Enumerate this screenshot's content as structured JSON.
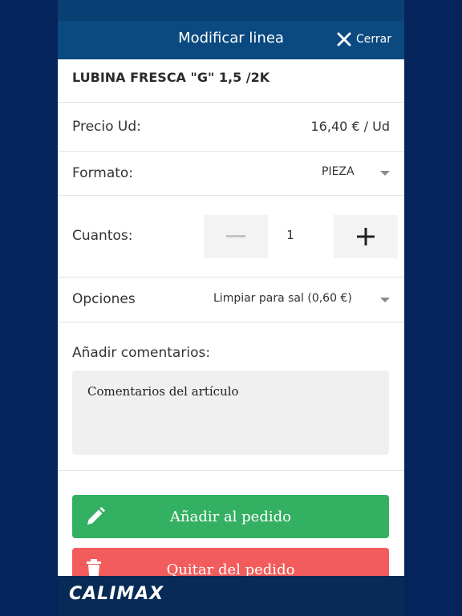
{
  "header": {
    "title": "Modificar linea",
    "close_label": "Cerrar"
  },
  "product": {
    "name": "LUBINA FRESCA \"G\" 1,5 /2K"
  },
  "price": {
    "label": "Precio Ud:",
    "value": "16,40 € / Ud"
  },
  "format": {
    "label": "Formato:",
    "selected": "PIEZA"
  },
  "quantity": {
    "label": "Cuantos:",
    "value": "1"
  },
  "options": {
    "label": "Opciones",
    "selected": "Limpiar para sal (0,60 €)"
  },
  "comments": {
    "label": "Añadir comentarios:",
    "placeholder": "Comentarios del artículo"
  },
  "actions": {
    "add_label": "Añadir al pedido",
    "remove_label": "Quitar del pedido"
  },
  "footer": {
    "logo_text": "CALIMAX"
  },
  "colors": {
    "background": "#06245c",
    "header": "#0b4a80",
    "add": "#34b063",
    "remove": "#f25c5c"
  }
}
